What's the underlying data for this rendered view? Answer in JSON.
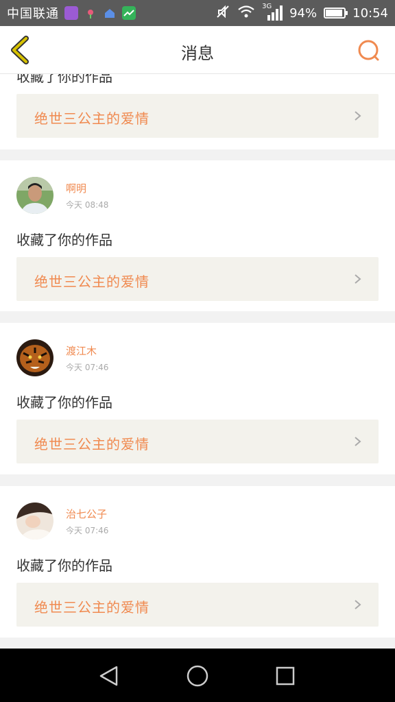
{
  "status_bar": {
    "carrier": "中国联通",
    "network": "3G",
    "battery_text": "94%",
    "battery_level": 0.94,
    "time": "10:54"
  },
  "header": {
    "title": "消息"
  },
  "colors": {
    "accent": "#f08a50",
    "back_arrow": "#d7c200",
    "card_bg": "#f3f2ec"
  },
  "first_card": {
    "action": "收藏了你的作品",
    "work_title": "绝世三公主的爱情"
  },
  "messages": [
    {
      "user": "啊明",
      "time": "今天 08:48",
      "action": "收藏了你的作品",
      "work_title": "绝世三公主的爱情"
    },
    {
      "user": "渡江木",
      "time": "今天 07:46",
      "action": "收藏了你的作品",
      "work_title": "绝世三公主的爱情"
    },
    {
      "user": "治七公子",
      "time": "今天 07:46",
      "action": "收藏了你的作品",
      "work_title": "绝世三公主的爱情"
    }
  ]
}
